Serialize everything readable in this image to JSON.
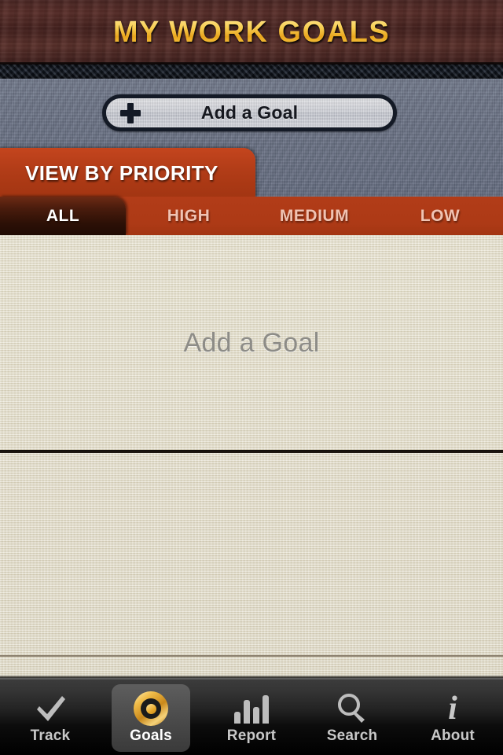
{
  "header": {
    "title": "MY WORK GOALS"
  },
  "toolbar": {
    "add_goal_label": "Add a Goal",
    "add_goal_icon": "plus-icon"
  },
  "priority": {
    "tab_label": "VIEW BY PRIORITY",
    "filters": [
      {
        "label": "ALL",
        "active": true
      },
      {
        "label": "HIGH",
        "active": false
      },
      {
        "label": "MEDIUM",
        "active": false
      },
      {
        "label": "LOW",
        "active": false
      }
    ]
  },
  "content": {
    "empty_label": "Add a Goal"
  },
  "tabbar": {
    "items": [
      {
        "label": "Track",
        "icon": "check-icon",
        "active": false
      },
      {
        "label": "Goals",
        "icon": "target-icon",
        "active": true
      },
      {
        "label": "Report",
        "icon": "bar-chart-icon",
        "active": false
      },
      {
        "label": "Search",
        "icon": "magnifier-icon",
        "active": false
      },
      {
        "label": "About",
        "icon": "info-icon",
        "active": false
      }
    ]
  },
  "colors": {
    "accent_orange": "#ae3a18",
    "accent_gold": "#f0bb33",
    "linen": "#e0dac5",
    "denim": "#6c7487",
    "wood": "#4b2724",
    "tabbar": "#222222"
  }
}
